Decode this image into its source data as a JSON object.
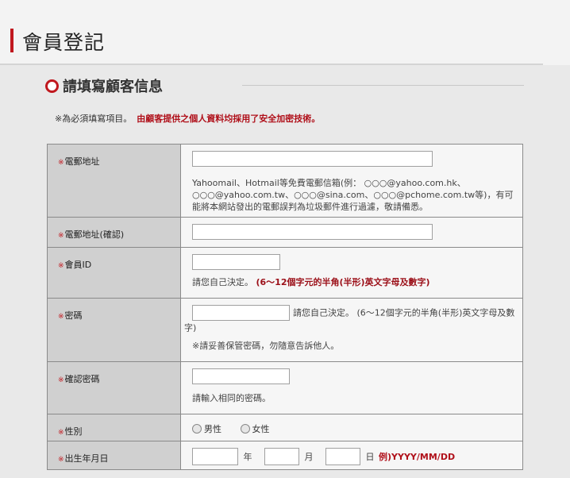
{
  "header": {
    "title": "會員登記"
  },
  "section": {
    "title": "請填寫顧客信息"
  },
  "notice": {
    "required": "※為必須填寫項目。",
    "secure": "由顧客提供之個人資料均採用了安全加密技術。"
  },
  "required_mark": "※",
  "fields": {
    "email": {
      "label": "電郵地址",
      "note": "Yahoomail、Hotmail等免費電郵信箱(例： ○○○@yahoo.com.hk、○○○@yahoo.com.tw、○○○@sina.com、○○○@pchome.com.tw等)，有可能將本網站發出的電郵誤判為垃圾郵件進行過濾，敬請備悉。"
    },
    "email_confirm": {
      "label": "電郵地址(確認)"
    },
    "member_id": {
      "label": "會員ID",
      "note_prefix": "請您自己決定。",
      "note_rule": "(6～12個字元的半角(半形)英文字母及數字)"
    },
    "password": {
      "label": "密碼",
      "inline_note": "請您自己決定。 (6～12個字元的半角(半形)英文字母及數字)",
      "warning": "※請妥善保管密碼，勿隨意告訴他人。"
    },
    "password_confirm": {
      "label": "確認密碼",
      "note": "請輸入相同的密碼。"
    },
    "gender": {
      "label": "性別",
      "options": [
        "男性",
        "女性"
      ]
    },
    "birthday": {
      "label": "出生年月日",
      "year": "年",
      "month": "月",
      "day": "日",
      "example": "例)YYYY/MM/DD"
    }
  }
}
